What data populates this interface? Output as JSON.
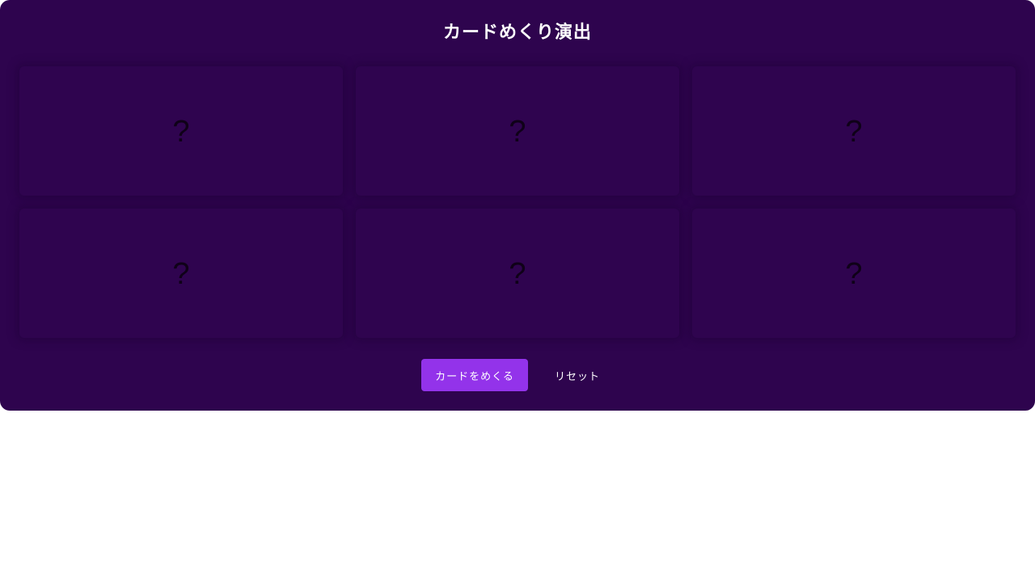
{
  "header": {
    "title": "カードめくり演出"
  },
  "cards": [
    {
      "mark": "?"
    },
    {
      "mark": "?"
    },
    {
      "mark": "?"
    },
    {
      "mark": "?"
    },
    {
      "mark": "?"
    },
    {
      "mark": "?"
    }
  ],
  "actions": {
    "flip_label": "カードをめくる",
    "reset_label": "リセット"
  },
  "colors": {
    "panel_background": "#2e044e",
    "card_background": "#2f044f",
    "primary_button": "#9333ea",
    "text": "#ffffff"
  }
}
